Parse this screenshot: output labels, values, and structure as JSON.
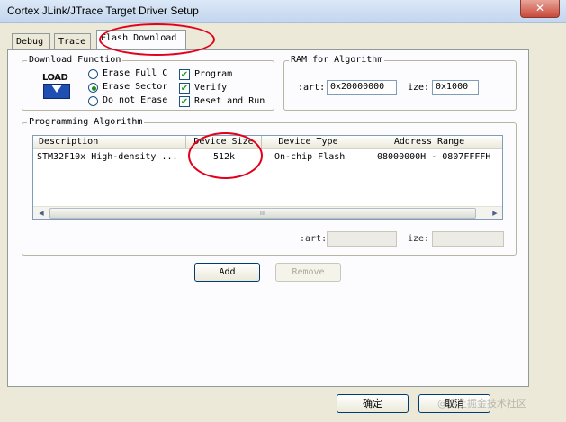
{
  "window": {
    "title": "Cortex JLink/JTrace Target Driver Setup",
    "close_glyph": "✕"
  },
  "tabs": [
    {
      "label": "Debug"
    },
    {
      "label": "Trace"
    },
    {
      "label": "Flash Download"
    }
  ],
  "download_function": {
    "title": "Download Function",
    "logo_text": "LOAD",
    "radios": [
      {
        "label": "Erase Full C",
        "selected": false
      },
      {
        "label": "Erase Sector",
        "selected": true
      },
      {
        "label": "Do not Erase",
        "selected": false
      }
    ],
    "checks": [
      {
        "label": "Program",
        "checked": true
      },
      {
        "label": "Verify",
        "checked": true
      },
      {
        "label": "Reset and Run",
        "checked": true
      }
    ],
    "check_glyph": "✔"
  },
  "ram": {
    "title": "RAM for Algorithm",
    "start_label": ":art:",
    "start_value": "0x20000000",
    "size_label": "ize:",
    "size_value": "0x1000"
  },
  "programming": {
    "title": "Programming Algorithm",
    "columns": [
      "Description",
      "Device Size",
      "Device Type",
      "Address Range"
    ],
    "rows": [
      {
        "description": "STM32F10x High-density ...",
        "size": "512k",
        "type": "On-chip Flash",
        "range": "08000000H - 0807FFFFH"
      }
    ],
    "scroll_left": "◀",
    "scroll_right": "▶",
    "scroll_grip": "III",
    "start_label": ":art:",
    "size_label": "ize:",
    "start_value": "",
    "size_value": ""
  },
  "buttons": {
    "add": "Add",
    "remove": "Remove",
    "ok": "确定",
    "cancel": "取消"
  },
  "watermark": "@掘土掘金技术社区",
  "annotation_color": "#e3001b"
}
